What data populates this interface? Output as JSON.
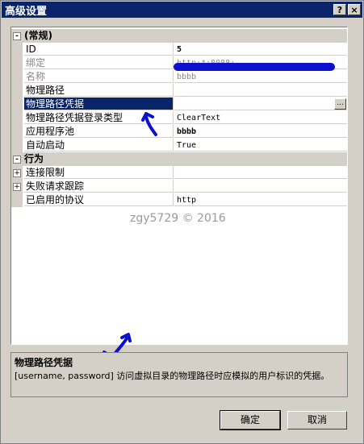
{
  "window": {
    "title": "高级设置",
    "help_btn": "?",
    "close_btn": "×"
  },
  "grid": {
    "categories": [
      {
        "label": "(常规)",
        "expander": "-"
      },
      {
        "label": "行为",
        "expander": "-"
      }
    ],
    "general": [
      {
        "name": "ID",
        "value": "5"
      },
      {
        "name": "绑定",
        "value": "http:*:8088:"
      },
      {
        "name": "名称",
        "value": "bbbb"
      },
      {
        "name": "物理路径",
        "value": ""
      },
      {
        "name": "物理路径凭据",
        "value": ""
      },
      {
        "name": "物理路径凭据登录类型",
        "value": "ClearText"
      },
      {
        "name": "应用程序池",
        "value": "bbbb"
      },
      {
        "name": "自动启动",
        "value": "True"
      }
    ],
    "behavior": [
      {
        "name": "连接限制",
        "value": "",
        "expander": "+"
      },
      {
        "name": "失败请求跟踪",
        "value": "",
        "expander": "+"
      },
      {
        "name": "已启用的协议",
        "value": "http"
      }
    ],
    "ellipsis": "..."
  },
  "watermark": "zgy5729 © 2016",
  "description": {
    "title": "物理路径凭据",
    "text": "[username, password] 访问虚拟目录的物理路径时应模拟的用户标识的凭据。"
  },
  "buttons": {
    "ok": "确定",
    "cancel": "取消"
  },
  "colors": {
    "selection": "#0a246a",
    "annotation_ink": "#0b10d0"
  }
}
